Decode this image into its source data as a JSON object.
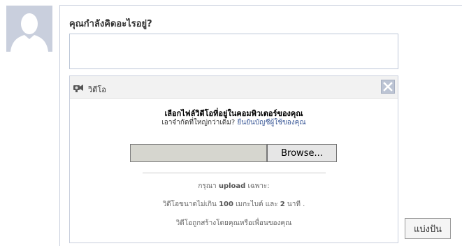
{
  "composer": {
    "prompt": "คุณกำลังคิดอะไรอยู่?",
    "status_value": ""
  },
  "video": {
    "title": "วิดีโอ",
    "choose_text": "เลือกไฟล์วิดีโอที่อยู่ในคอมพิวเตอร์ของคุณ",
    "limit_question": "เอาจำกัดที่ใหญ่กว่าเดิม?",
    "verify_link": "ยืนยันบัญชีผู้ใช้ของคุณ",
    "file_path_value": "",
    "browse_label": "Browse...",
    "rules": {
      "line1_prefix": "กรุณา ",
      "line1_bold": "upload",
      "line1_suffix": " เฉพาะ:",
      "line2_prefix": "วิดีโอขนาดไม่เกิน ",
      "line2_size": "100",
      "line2_mid": " เมกะไบต์ และ ",
      "line2_minutes": "2",
      "line2_suffix": " นาที .",
      "line3": "วิดีโอถูกสร้างโดยคุณหรือเพื่อนของคุณ"
    }
  },
  "share_button": "แบ่งปัน",
  "colors": {
    "avatar_bg": "#c9cfdd",
    "link": "#3b5998",
    "border": "#bdc7d8"
  },
  "icons": {
    "avatar": "default-profile-silhouette",
    "video": "video-camera-icon",
    "close": "close-x-icon"
  }
}
